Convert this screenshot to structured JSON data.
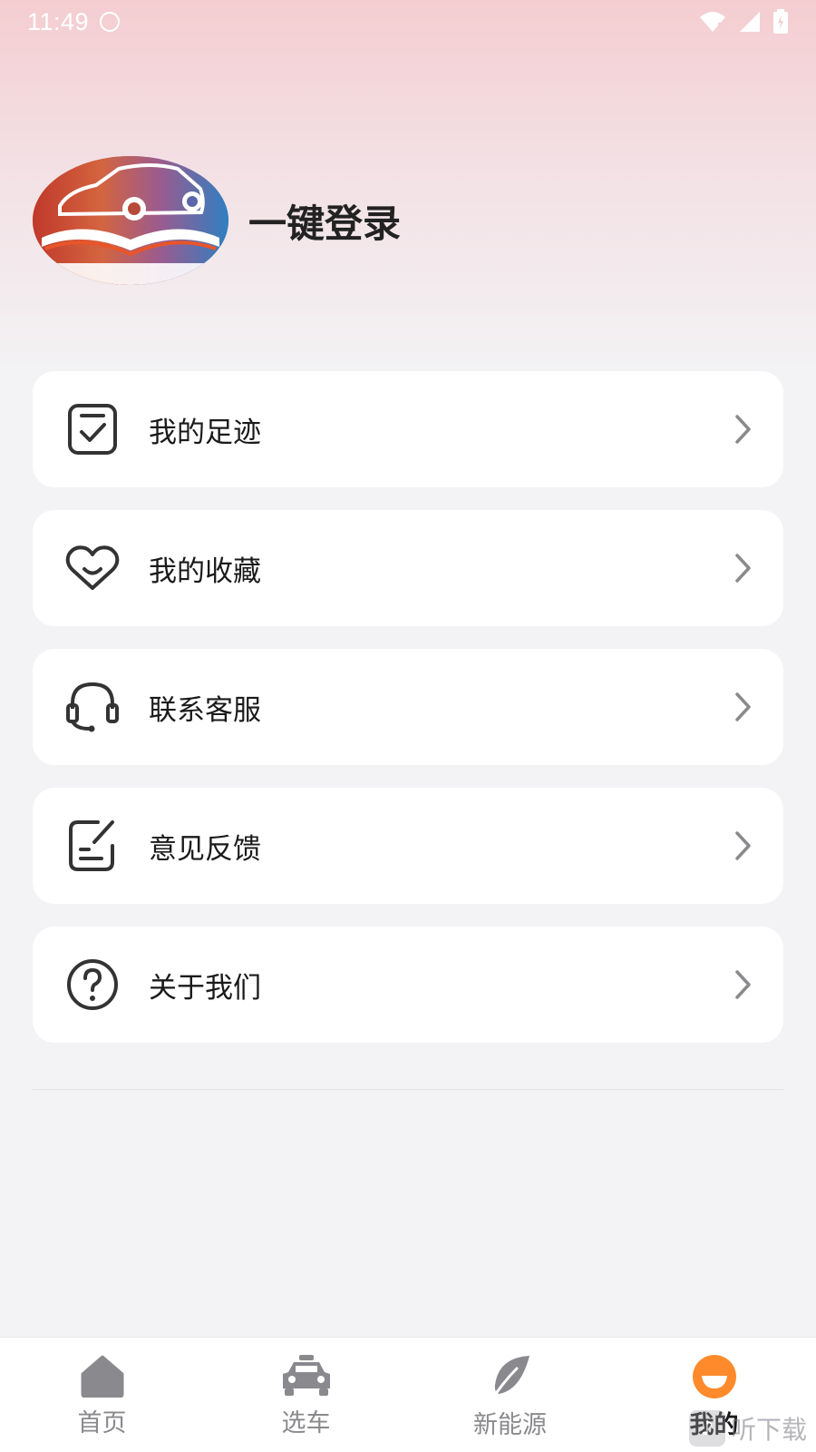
{
  "status_bar": {
    "time": "11:49"
  },
  "profile": {
    "login_label": "一键登录"
  },
  "menu": {
    "items": [
      {
        "label": "我的足迹",
        "icon": "footprint-checklist-icon"
      },
      {
        "label": "我的收藏",
        "icon": "heart-icon"
      },
      {
        "label": "联系客服",
        "icon": "headset-icon"
      },
      {
        "label": "意见反馈",
        "icon": "feedback-edit-icon"
      },
      {
        "label": "关于我们",
        "icon": "question-circle-icon"
      }
    ]
  },
  "tabbar": {
    "tabs": [
      {
        "label": "首页",
        "icon": "home-icon",
        "active": false
      },
      {
        "label": "选车",
        "icon": "car-icon",
        "active": false
      },
      {
        "label": "新能源",
        "icon": "leaf-icon",
        "active": false
      },
      {
        "label": "我的",
        "icon": "smile-face-icon",
        "active": true
      }
    ],
    "active_color": "#ff8a2b",
    "inactive_color": "#8a8a8e"
  },
  "watermark": {
    "text": "听下载"
  }
}
